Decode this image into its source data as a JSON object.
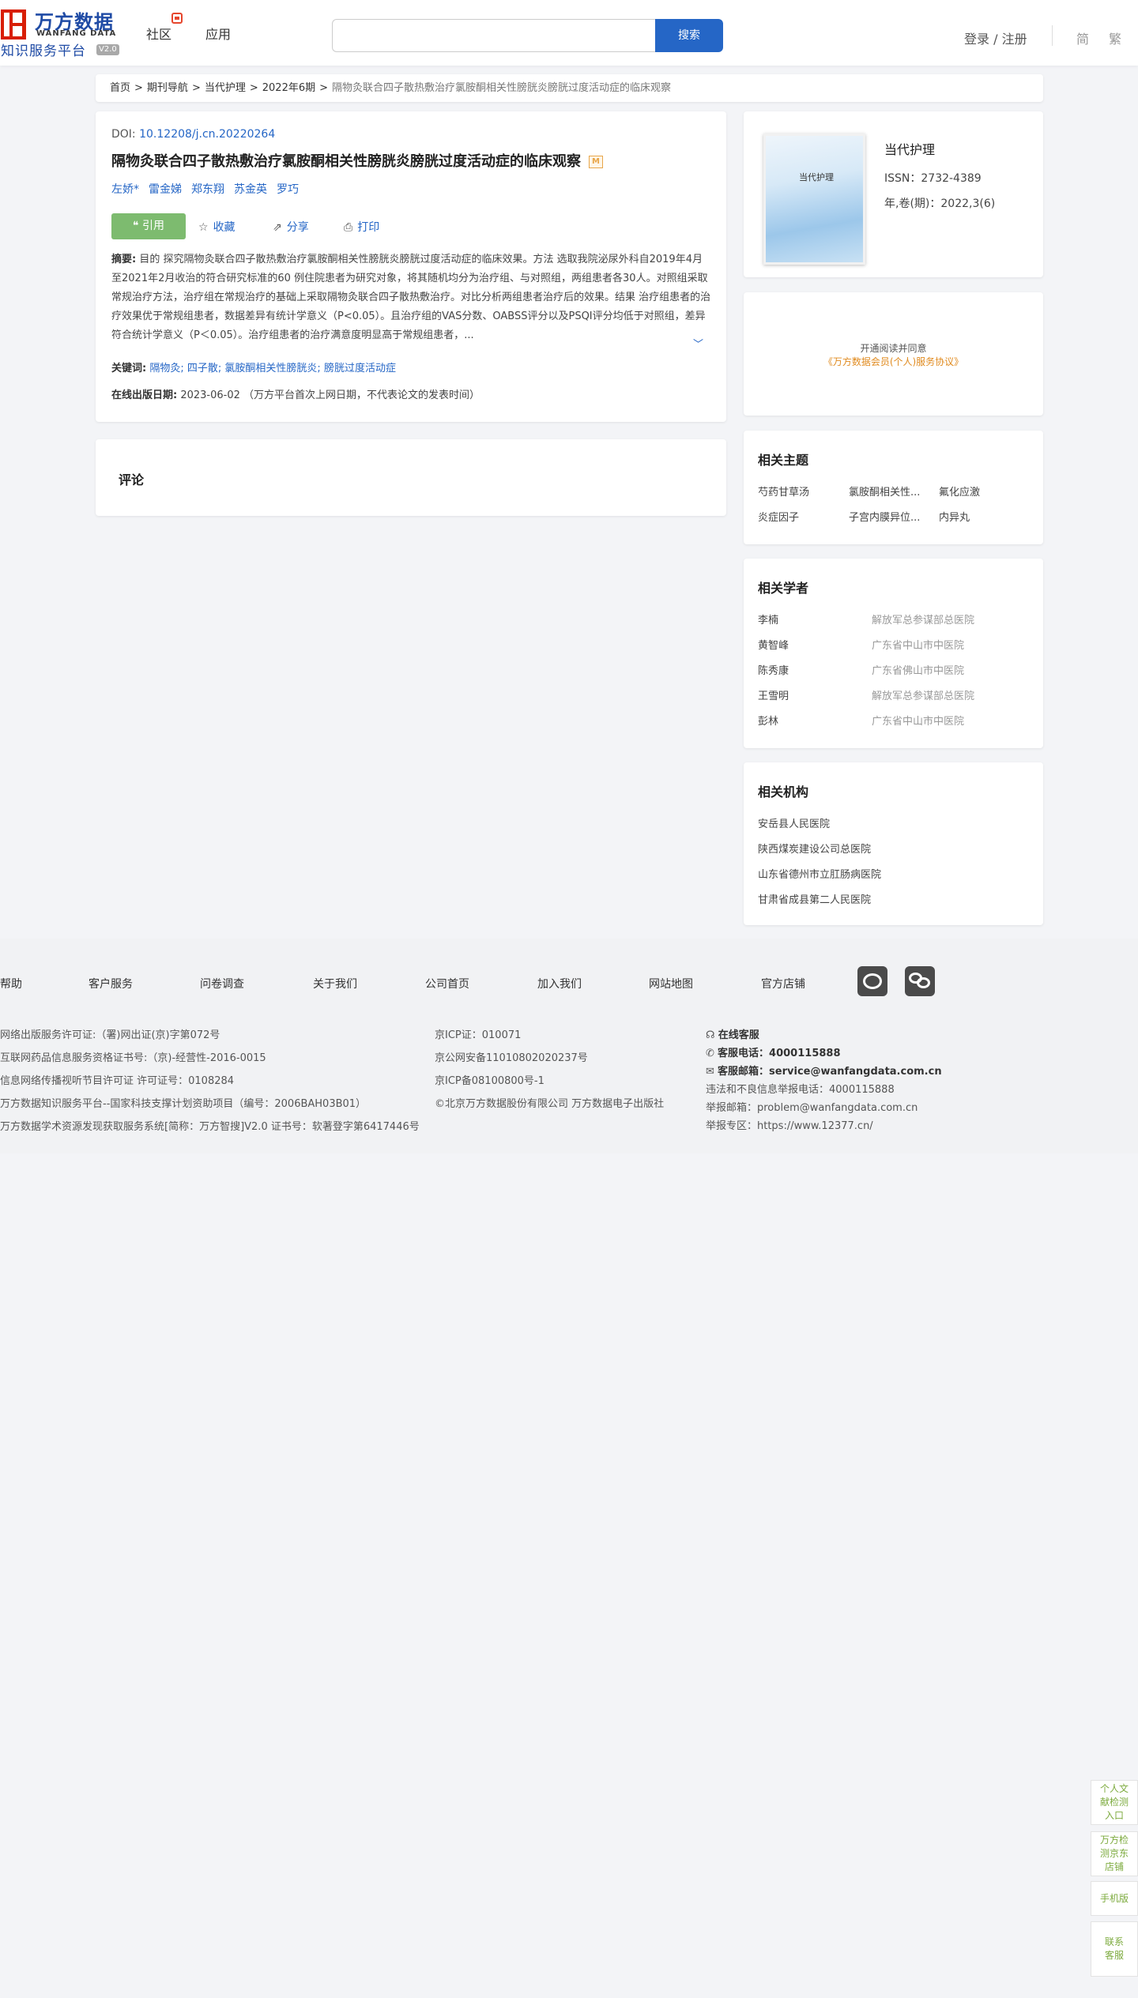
{
  "header": {
    "logo_cn": "万方数据",
    "logo_en": "WANFANG DATA",
    "logo_sub": "知识服务平台",
    "logo_ver": "V2.0",
    "nav": [
      "社区",
      "应用"
    ],
    "search_placeholder": "",
    "search_button": "搜索",
    "login": "登录 / 注册",
    "lang_simplified": "简",
    "lang_traditional": "繁"
  },
  "breadcrumb": {
    "items": [
      "首页",
      "期刊导航",
      "当代护理",
      "2022年6期"
    ],
    "separator": ">",
    "current": "隔物灸联合四子散热敷治疗氯胺酮相关性膀胱炎膀胱过度活动症的临床观察"
  },
  "article": {
    "doi_label": "DOI:",
    "doi": "10.12208/j.cn.20220264",
    "title": "隔物灸联合四子散热敷治疗氯胺酮相关性膀胱炎膀胱过度活动症的临床观察",
    "badge": "M",
    "authors": [
      "左娇*",
      "雷金娣",
      "郑东翔",
      "苏金英",
      "罗巧"
    ],
    "cite_label": "引用",
    "actions": [
      "收藏",
      "分享",
      "打印"
    ],
    "abstract_label": "摘要:",
    "abstract_text": "目的 探究隔物灸联合四子散热敷治疗氯胺酮相关性膀胱炎膀胱过度活动症的临床效果。方法 选取我院泌尿外科自2019年4月至2021年2月收治的符合研究标准的60 例住院患者为研究对象，将其随机均分为治疗组、与对照组，两组患者各30人。对照组采取常规治疗方法，治疗组在常规治疗的基础上采取隔物灸联合四子散热敷治疗。对比分析两组患者治疗后的效果。结果 治疗组患者的治疗效果优于常规组患者，数据差异有统计学意义（P<0.05）。且治疗组的VAS分数、OABSS评分以及PSQI评分均低于对照组，差异符合统计学意义（P＜0.05）。治疗组患者的治疗满意度明显高于常规组患者，...",
    "keywords_label": "关键词:",
    "keywords": [
      "隔物灸;",
      "四子散;",
      "氯胺酮相关性膀胱炎;",
      "膀胱过度活动症"
    ],
    "pubdate_label": "在线出版日期:",
    "pubdate": "2023-06-02 （万方平台首次上网日期，不代表论文的发表时间）"
  },
  "comments": {
    "title": "评论"
  },
  "journal": {
    "cover_text": "当代护理",
    "name": "当代护理",
    "issn": "ISSN：2732-4389",
    "year": "年,卷(期)：2022,3(6)"
  },
  "agreement": {
    "line1": "开通阅读并同意",
    "line2": "《万方数据会员(个人)服务协议》"
  },
  "related_topics": {
    "title": "相关主题",
    "items": [
      "芍药甘草汤",
      "氯胺酮相关性...",
      "氟化应激",
      "炎症因子",
      "子宫内膜异位...",
      "内异丸"
    ]
  },
  "related_scholars": {
    "title": "相关学者",
    "items": [
      {
        "name": "李楠",
        "affiliation": "解放军总参谋部总医院"
      },
      {
        "name": "黄智峰",
        "affiliation": "广东省中山市中医院"
      },
      {
        "name": "陈秀康",
        "affiliation": "广东省佛山市中医院"
      },
      {
        "name": "王雪明",
        "affiliation": "解放军总参谋部总医院"
      },
      {
        "name": "彭林",
        "affiliation": "广东省中山市中医院"
      }
    ]
  },
  "related_orgs": {
    "title": "相关机构",
    "items": [
      "安岳县人民医院",
      "陕西煤炭建设公司总医院",
      "山东省德州市立肛肠病医院",
      "甘肃省成县第二人民医院"
    ]
  },
  "footer": {
    "nav": [
      "帮助",
      "客户服务",
      "问卷调查",
      "关于我们",
      "公司首页",
      "加入我们",
      "网站地图",
      "官方店铺"
    ],
    "col1": [
      "网络出版服务许可证:（署)网出证(京)字第072号",
      "互联网药品信息服务资格证书号:（京)-经营性-2016-0015",
      "信息网络传播视听节目许可证 许可证号：0108284",
      "万方数据知识服务平台--国家科技支撑计划资助项目（编号：2006BAH03B01）",
      "万方数据学术资源发现获取服务系统[简称：万方智搜]V2.0 证书号：软著登字第6417446号"
    ],
    "col2": [
      "京ICP证：010071",
      "京公网安备11010802020237号",
      "京ICP备08100800号-1",
      "©北京万方数据股份有限公司 万方数据电子出版社"
    ],
    "online_service": "在线客服",
    "phone_label": "客服电话：",
    "phone": "4000115888",
    "email_label": "客服邮箱：",
    "email": "service@wanfangdata.com.cn",
    "col3": [
      "违法和不良信息举报电话：4000115888",
      "举报邮箱：problem@wanfangdata.com.cn",
      "举报专区：https://www.12377.cn/"
    ]
  },
  "float_bar": [
    "个人文献检测入口",
    "万方检测京东店铺",
    "手机版",
    "联系客服"
  ]
}
